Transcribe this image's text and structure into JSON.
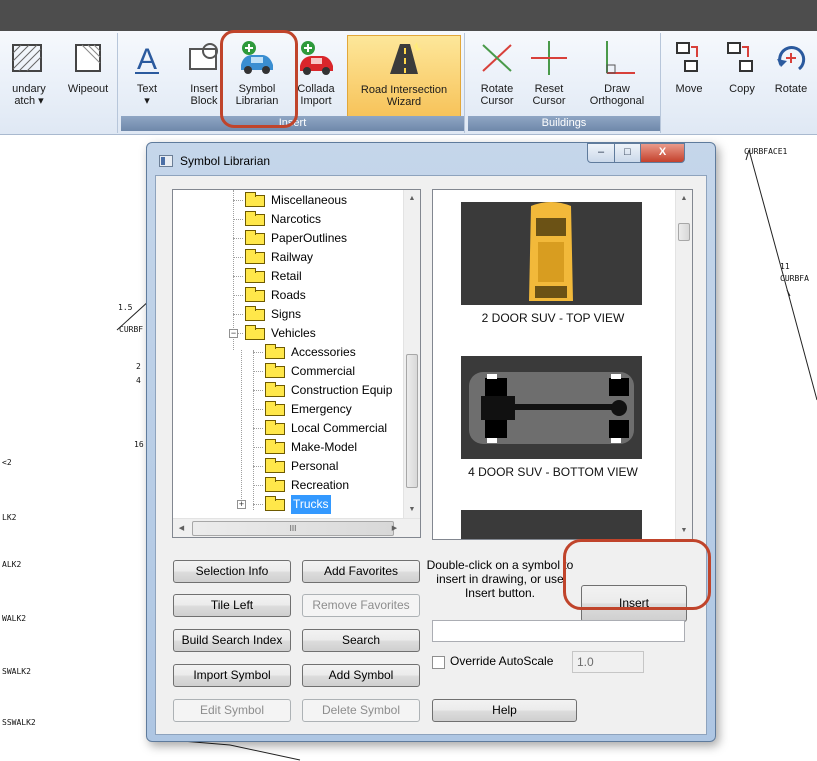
{
  "ribbon": {
    "groups": [
      {
        "label": "Insert"
      },
      {
        "label": "Buildings"
      }
    ],
    "buttons": [
      {
        "key": "boundary-hatch",
        "label1": "undary",
        "label2": "atch ▾"
      },
      {
        "key": "wipeout",
        "label1": "Wipeout",
        "label2": ""
      },
      {
        "key": "text",
        "label1": "Text",
        "label2": "▾"
      },
      {
        "key": "insert-block",
        "label1": "Insert",
        "label2": "Block"
      },
      {
        "key": "symbol-librarian",
        "label1": "Symbol",
        "label2": "Librarian"
      },
      {
        "key": "collada-import",
        "label1": "Collada",
        "label2": "Import"
      },
      {
        "key": "road-wizard",
        "label1": "Road Intersection",
        "label2": "Wizard"
      },
      {
        "key": "rotate-cursor",
        "label1": "Rotate",
        "label2": "Cursor"
      },
      {
        "key": "reset-cursor",
        "label1": "Reset",
        "label2": "Cursor"
      },
      {
        "key": "draw-orthogonal",
        "label1": "Draw",
        "label2": "Orthogonal"
      },
      {
        "key": "move",
        "label1": "Move",
        "label2": ""
      },
      {
        "key": "copy",
        "label1": "Copy",
        "label2": ""
      },
      {
        "key": "rotate",
        "label1": "Rotate",
        "label2": ""
      }
    ]
  },
  "drawing_labels": [
    "CURBFACE1",
    "CURBFA",
    "CURBF",
    "<2",
    "LK2",
    "ALK2",
    "WALK2",
    "SWALK2",
    "SSWALK2",
    "1.5",
    "2",
    "11",
    "16",
    "4"
  ],
  "dialog": {
    "title": "Symbol Librarian",
    "window_buttons": {
      "minimize": "–",
      "maximize": "□",
      "close": "X"
    },
    "tree": {
      "items": [
        {
          "label": "Miscellaneous",
          "level": 1
        },
        {
          "label": "Narcotics",
          "level": 1
        },
        {
          "label": "PaperOutlines",
          "level": 1
        },
        {
          "label": "Railway",
          "level": 1
        },
        {
          "label": "Retail",
          "level": 1
        },
        {
          "label": "Roads",
          "level": 1
        },
        {
          "label": "Signs",
          "level": 1
        },
        {
          "label": "Vehicles",
          "level": 1,
          "expanded": true
        },
        {
          "label": "Accessories",
          "level": 2
        },
        {
          "label": "Commercial",
          "level": 2
        },
        {
          "label": "Construction Equip",
          "level": 2
        },
        {
          "label": "Emergency",
          "level": 2
        },
        {
          "label": "Local Commercial",
          "level": 2
        },
        {
          "label": "Make-Model",
          "level": 2
        },
        {
          "label": "Personal",
          "level": 2
        },
        {
          "label": "Recreation",
          "level": 2
        },
        {
          "label": "Trucks",
          "level": 2,
          "selected": true
        }
      ],
      "hscroll_thumb_text": "III"
    },
    "preview": {
      "symbols": [
        {
          "label": "2 DOOR SUV - TOP VIEW"
        },
        {
          "label": "4 DOOR SUV - BOTTOM VIEW"
        }
      ]
    },
    "buttons": {
      "selection_info": "Selection Info",
      "add_favorites": "Add Favorites",
      "tile_left": "Tile Left",
      "remove_favorites": "Remove Favorites",
      "build_search_index": "Build Search Index",
      "search": "Search",
      "import_symbol": "Import Symbol",
      "add_symbol": "Add Symbol",
      "edit_symbol": "Edit Symbol",
      "delete_symbol": "Delete Symbol",
      "help": "Help",
      "insert": "Insert"
    },
    "hint": "Double-click on a symbol to insert in drawing, or use Insert button.",
    "search_value": "",
    "override_label": "Override AutoScale",
    "override_checked": false,
    "autoscale_value": "1.0"
  },
  "colors": {
    "highlight_ring": "#c0442b",
    "tree_selection": "#3399ff",
    "folder": "#ffe74a",
    "wizard_button": "#f7c35a"
  }
}
